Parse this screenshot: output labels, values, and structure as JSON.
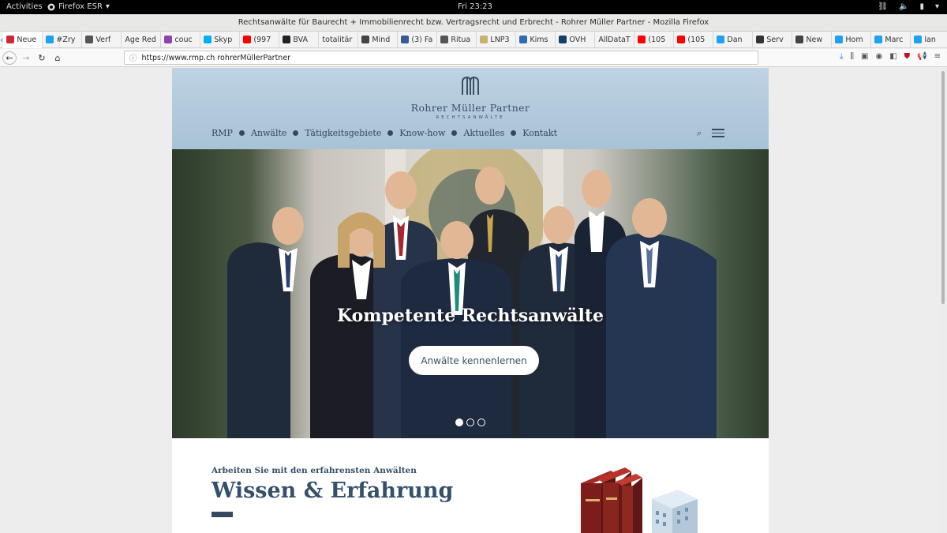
{
  "system_bar": {
    "activities": "Activities",
    "app_name": "Firefox ESR",
    "clock": "Fri 23:23"
  },
  "window": {
    "title": "Rechtsanwälte für Baurecht + Immobilienrecht bzw. Vertragsrecht und Erbrecht - Rohrer Müller Partner - Mozilla Firefox"
  },
  "tabs": [
    {
      "label": "Neue",
      "icon": "zotero-icon",
      "color": "#cc2936"
    },
    {
      "label": "#Zry",
      "icon": "twitter-icon",
      "color": "#1da1f2"
    },
    {
      "label": "Verf",
      "icon": "wikipedia-icon",
      "color": "#555555"
    },
    {
      "label": "Age Red",
      "icon": "",
      "color": ""
    },
    {
      "label": "couc",
      "icon": "m-icon",
      "color": "#8e44ad"
    },
    {
      "label": "Skyp",
      "icon": "skype-icon",
      "color": "#00aff0"
    },
    {
      "label": "(997",
      "icon": "youtube-icon",
      "color": "#ff0000"
    },
    {
      "label": "BVA",
      "icon": "github-icon",
      "color": "#222222"
    },
    {
      "label": "totalitär",
      "icon": "",
      "color": ""
    },
    {
      "label": "Mind",
      "icon": "sv-icon",
      "color": "#444444"
    },
    {
      "label": "(3) Fa",
      "icon": "facebook-icon",
      "color": "#3b5998"
    },
    {
      "label": "Ritua",
      "icon": "wikipedia-icon",
      "color": "#555555"
    },
    {
      "label": "LNP3",
      "icon": "doc-icon",
      "color": "#c9b26b"
    },
    {
      "label": "Kims",
      "icon": "kims-icon",
      "color": "#2d6cb5"
    },
    {
      "label": "OVH",
      "icon": "ovh-icon",
      "color": "#123f6d"
    },
    {
      "label": "AllDataT",
      "icon": "",
      "color": ""
    },
    {
      "label": "(105",
      "icon": "youtube-icon",
      "color": "#ff0000"
    },
    {
      "label": "(105",
      "icon": "youtube-icon",
      "color": "#ff0000"
    },
    {
      "label": "Dan",
      "icon": "twitter-icon",
      "color": "#1da1f2"
    },
    {
      "label": "Serv",
      "icon": "warning-icon",
      "color": "#333333"
    },
    {
      "label": "New",
      "icon": "wsm-icon",
      "color": "#444444"
    },
    {
      "label": "Hom",
      "icon": "twitter-icon",
      "color": "#1da1f2"
    },
    {
      "label": "Marc",
      "icon": "twitter-icon",
      "color": "#1da1f2"
    },
    {
      "label": "lan",
      "icon": "twitter-icon",
      "color": "#1da1f2"
    }
  ],
  "nav": {
    "url": "https://www.rmp.ch rohrerMüllerPartner"
  },
  "site": {
    "logo_name": "Rohrer Müller Partner",
    "logo_sub": "RECHTSANWÄLTE",
    "menu": [
      "RMP",
      "Anwälte",
      "Tätigkeitsgebiete",
      "Know-how",
      "Aktuelles",
      "Kontakt"
    ],
    "hero": {
      "headline": "Kompetente Rechtsanwälte",
      "button": "Anwälte kennenlernen",
      "slides_total": 3,
      "active_slide": 1
    },
    "intro": {
      "subtitle": "Arbeiten Sie mit den erfahrensten Anwälten",
      "title": "Wissen & Erfahrung"
    }
  },
  "colors": {
    "brand": "#34495c",
    "header_bg": "#b5cbdc"
  }
}
